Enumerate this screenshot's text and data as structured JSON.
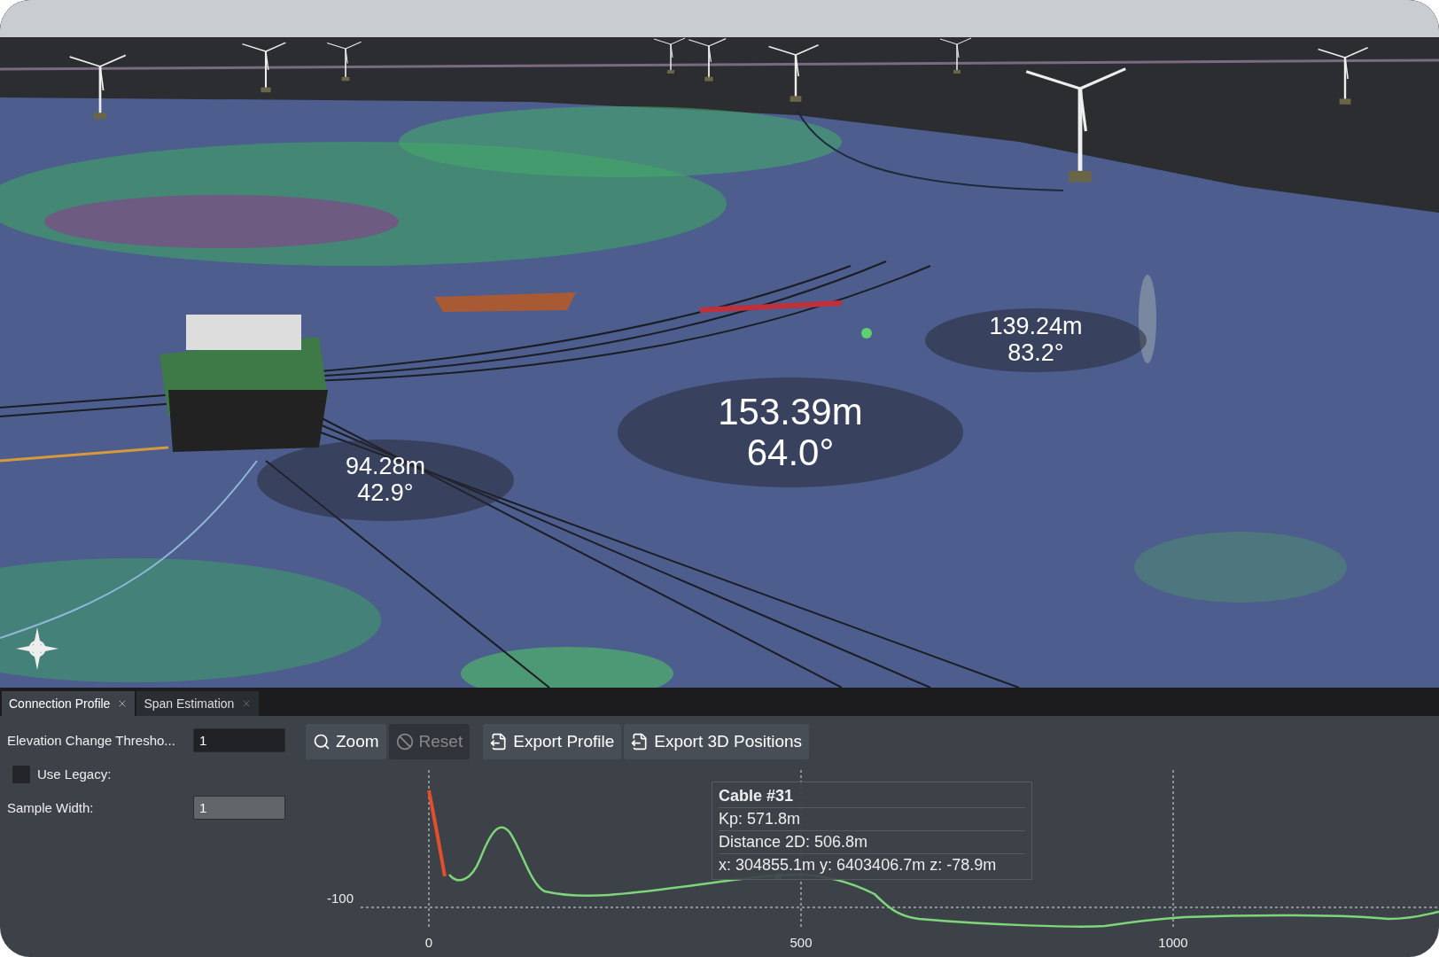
{
  "scene": {
    "measurements": [
      {
        "distance": "94.28m",
        "angle": "42.9°"
      },
      {
        "distance": "153.39m",
        "angle": "64.0°"
      },
      {
        "distance": "139.24m",
        "angle": "83.2°"
      }
    ]
  },
  "tabs": [
    {
      "label": "Connection Profile",
      "selected": true
    },
    {
      "label": "Span Estimation",
      "selected": false
    }
  ],
  "settings": {
    "threshold": {
      "label": "Elevation Change Thresho...",
      "value": "1",
      "disabled": false
    },
    "use_legacy": {
      "label": "Use Legacy:",
      "checked": false
    },
    "sample_width": {
      "label": "Sample Width:",
      "value": "1",
      "disabled": true
    }
  },
  "toolbar": [
    {
      "label": "Zoom",
      "kind": "zoom",
      "disabled": false
    },
    {
      "label": "Reset",
      "kind": "reset",
      "disabled": true
    },
    {
      "label": "Export Profile",
      "kind": "export",
      "disabled": false
    },
    {
      "label": "Export 3D Positions",
      "kind": "export",
      "disabled": false
    }
  ],
  "profile": {
    "x_ticks": [
      "0",
      "500",
      "1000"
    ],
    "y_ticks": [
      "-100"
    ],
    "tooltip": {
      "title": "Cable #31",
      "lines": [
        "Kp: 571.8m",
        "Distance 2D: 506.8m",
        "x: 304855.1m y: 6403406.7m z: -78.9m"
      ]
    }
  }
}
